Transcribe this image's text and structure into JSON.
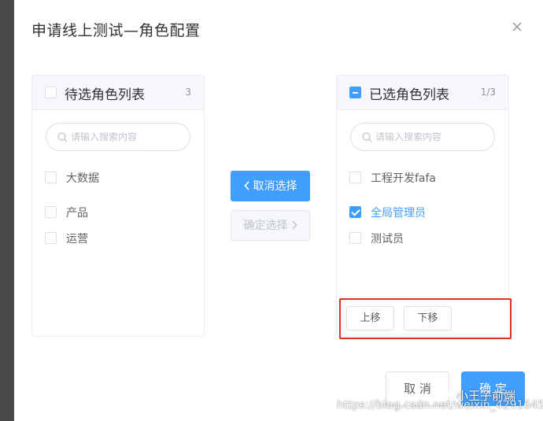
{
  "dialog": {
    "title": "申请线上测试—角色配置"
  },
  "left_panel": {
    "title": "待选角色列表",
    "count": "3",
    "all_checked": false,
    "search_placeholder": "请输入搜索内容",
    "items": [
      {
        "label": "大数据",
        "checked": false
      },
      {
        "label": "产品",
        "checked": false
      },
      {
        "label": "运营",
        "checked": false
      }
    ]
  },
  "right_panel": {
    "title": "已选角色列表",
    "count": "1/3",
    "all_state": "indeterminate",
    "search_placeholder": "请输入搜索内容",
    "items": [
      {
        "label": "工程开发fafa",
        "checked": false
      },
      {
        "label": "全局管理员",
        "checked": true
      },
      {
        "label": "测试员",
        "checked": false
      }
    ],
    "move_up_label": "上移",
    "move_down_label": "下移"
  },
  "transfer": {
    "cancel_select_label": "取消选择",
    "confirm_select_label": "确定选择",
    "cancel_select_icon": "chevron-left-icon",
    "confirm_select_icon": "chevron-right-icon"
  },
  "footer": {
    "cancel_label": "取 消",
    "ok_label": "确 定"
  },
  "watermark": {
    "brand": "小王子前端",
    "url": "https://blog.csdn.net/weixin_42916452"
  },
  "colors": {
    "primary": "#409eff",
    "highlight_box": "#e0302a",
    "text": "#606266",
    "title": "#303133"
  }
}
